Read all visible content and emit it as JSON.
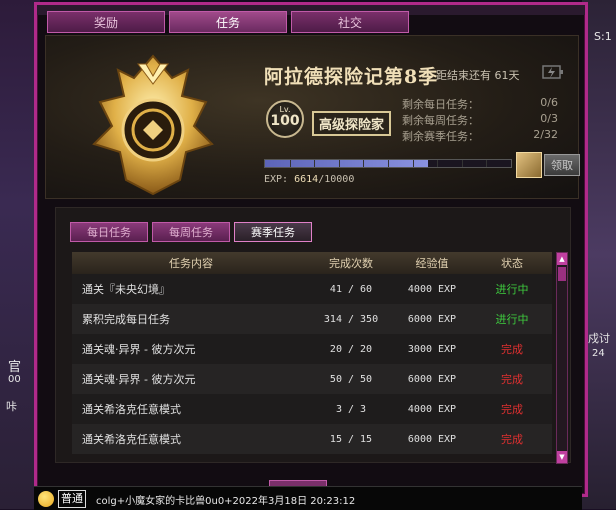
{
  "window": {
    "tabs": [
      "奖励",
      "任务",
      "社交"
    ],
    "active_tab": "任务"
  },
  "header": {
    "season_title": "阿拉德探险记第8季",
    "countdown": "距结束还有 61天",
    "level_prefix": "Lv.",
    "level": "100",
    "rank": "高级探险家",
    "remaining": [
      {
        "label": "剩余每日任务：",
        "value": "0/6"
      },
      {
        "label": "剩余每周任务：",
        "value": "0/3"
      },
      {
        "label": "剩余赛季任务：",
        "value": "2/32"
      }
    ],
    "exp_label": "EXP:",
    "exp_current": "6614",
    "exp_total": "/10000",
    "exp_fraction": 0.6614,
    "claim_label": "领取"
  },
  "tasks": {
    "subtabs": [
      "每日任务",
      "每周任务",
      "赛季任务"
    ],
    "active_subtab": "赛季任务",
    "columns": [
      "任务内容",
      "完成次数",
      "经验值",
      "状态"
    ],
    "rows": [
      {
        "name": "通关『未央幻境』",
        "count": "41 / 60",
        "exp": "4000 EXP",
        "status": "进行中"
      },
      {
        "name": "累积完成每日任务",
        "count": "314 / 350",
        "exp": "6000 EXP",
        "status": "进行中"
      },
      {
        "name": "通关魂·异界 - 彼方次元",
        "count": "20 / 20",
        "exp": "3000 EXP",
        "status": "完成"
      },
      {
        "name": "通关魂·异界 - 彼方次元",
        "count": "50 / 50",
        "exp": "6000 EXP",
        "status": "完成"
      },
      {
        "name": "通关希洛克任意模式",
        "count": "3 / 3",
        "exp": "4000 EXP",
        "status": "完成"
      },
      {
        "name": "通关希洛克任意模式",
        "count": "15 / 15",
        "exp": "6000 EXP",
        "status": "完成"
      }
    ]
  },
  "chat": {
    "channel": "普通",
    "input": "colg+小魔女家的卡比兽0u0+2022年3月18日 20:23:12"
  },
  "edges": {
    "right_top": "S:1",
    "left_mid": "官",
    "left_mid2": "00",
    "left_low": "咔",
    "right_mid": "戍讨",
    "right_mid2": "24"
  },
  "colors": {
    "frame": "#b02a8a",
    "status_progress": "#3ecb3e",
    "status_done": "#e03030"
  }
}
